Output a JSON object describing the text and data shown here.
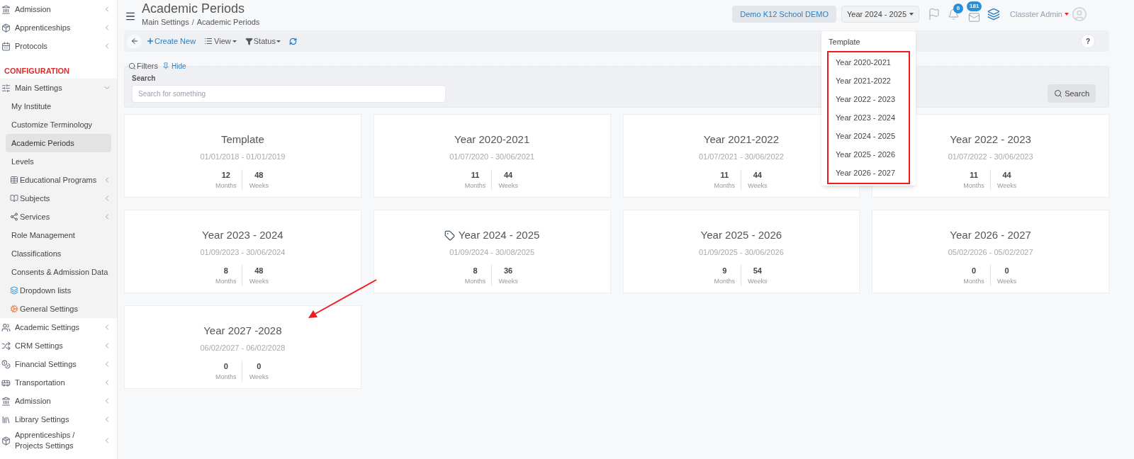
{
  "sidebar": {
    "items": [
      {
        "label": "Admission",
        "expanded": false
      },
      {
        "label": "Apprenticeships",
        "expanded": false
      },
      {
        "label": "Protocols",
        "expanded": false
      },
      {
        "kind": "heading",
        "label": "CONFIGURATION"
      },
      {
        "label": "Main Settings",
        "expanded": true,
        "children": [
          {
            "label": "My Institute",
            "selected": false
          },
          {
            "label": "Customize Terminology",
            "selected": false
          },
          {
            "label": "Academic Periods",
            "selected": true
          },
          {
            "label": "Levels",
            "selected": false
          },
          {
            "label": "Educational Programs",
            "selected": false,
            "expanded": false
          },
          {
            "label": "Subjects",
            "selected": false,
            "expanded": false
          },
          {
            "label": "Services",
            "selected": false,
            "expanded": false
          },
          {
            "label": "Role Management",
            "selected": false
          },
          {
            "label": "Classifications",
            "selected": false
          },
          {
            "label": "Consents & Admission Data",
            "selected": false
          },
          {
            "label": "Dropdown lists",
            "selected": false
          },
          {
            "label": "General Settings",
            "selected": false
          }
        ]
      },
      {
        "label": "Academic Settings",
        "expanded": false
      },
      {
        "label": "CRM Settings",
        "expanded": false
      },
      {
        "label": "Financial Settings",
        "expanded": false
      },
      {
        "label": "Transportation",
        "expanded": false
      },
      {
        "label": "Admission",
        "expanded": false
      },
      {
        "label": "Library Settings",
        "expanded": false
      },
      {
        "label": "Apprenticeships / Projects Settings",
        "expanded": false
      }
    ]
  },
  "header": {
    "title": "Academic Periods",
    "breadcrumb": [
      "Main Settings",
      "Academic Periods"
    ],
    "breadcrumb_separator": "/",
    "school": "Demo K12 School DEMO",
    "year": "Year 2024 - 2025",
    "notifications": "0",
    "messages": "181",
    "user": "Classter Admin"
  },
  "year_menu": [
    {
      "label": "Template",
      "selected": false,
      "highlighted": false
    },
    {
      "label": "Year 2020-2021",
      "selected": false,
      "highlighted": true
    },
    {
      "label": "Year 2021-2022",
      "selected": false,
      "highlighted": true
    },
    {
      "label": "Year 2022 - 2023",
      "selected": false,
      "highlighted": true
    },
    {
      "label": "Year 2023 - 2024",
      "selected": false,
      "highlighted": true
    },
    {
      "label": "Year 2024 - 2025",
      "selected": false,
      "highlighted": true
    },
    {
      "label": "Year 2025 - 2026",
      "selected": false,
      "highlighted": true
    },
    {
      "label": "Year 2026 - 2027",
      "selected": false,
      "highlighted": true
    }
  ],
  "toolbar": {
    "create": "Create New",
    "view": "View",
    "status": "Status",
    "help": "?"
  },
  "filters": {
    "title": "Filters",
    "hide": "Hide",
    "search_label": "Search",
    "placeholder": "Search for something",
    "button": "Search"
  },
  "cards": [
    {
      "title": "Template",
      "dates": "01/01/2018 - 01/01/2019",
      "months": "12",
      "weeks": "48",
      "months_label": "Months",
      "weeks_label": "Weeks",
      "current": false
    },
    {
      "title": "Year 2020-2021",
      "dates": "01/07/2020 - 30/06/2021",
      "months": "11",
      "weeks": "44",
      "months_label": "Months",
      "weeks_label": "Weeks",
      "current": false
    },
    {
      "title": "Year 2021-2022",
      "dates": "01/07/2021 - 30/06/2022",
      "months": "11",
      "weeks": "44",
      "months_label": "Months",
      "weeks_label": "Weeks",
      "current": false
    },
    {
      "title": "Year 2022 - 2023",
      "dates": "01/07/2022 - 30/06/2023",
      "months": "11",
      "weeks": "44",
      "months_label": "Months",
      "weeks_label": "Weeks",
      "current": false
    },
    {
      "title": "Year 2023 - 2024",
      "dates": "01/09/2023 - 30/06/2024",
      "months": "8",
      "weeks": "48",
      "months_label": "Months",
      "weeks_label": "Weeks",
      "current": false
    },
    {
      "title": "Year 2024 - 2025",
      "dates": "01/09/2024 - 30/08/2025",
      "months": "8",
      "weeks": "36",
      "months_label": "Months",
      "weeks_label": "Weeks",
      "current": true
    },
    {
      "title": "Year 2025 - 2026",
      "dates": "01/09/2025 - 30/06/2026",
      "months": "9",
      "weeks": "54",
      "months_label": "Months",
      "weeks_label": "Weeks",
      "current": false
    },
    {
      "title": "Year 2026 - 2027",
      "dates": "05/02/2026 - 05/02/2027",
      "months": "0",
      "weeks": "0",
      "months_label": "Months",
      "weeks_label": "Weeks",
      "current": false
    },
    {
      "title": "Year 2027 -2028",
      "dates": "06/02/2027 - 06/02/2028",
      "months": "0",
      "weeks": "0",
      "months_label": "Months",
      "weeks_label": "Weeks",
      "current": false
    }
  ]
}
